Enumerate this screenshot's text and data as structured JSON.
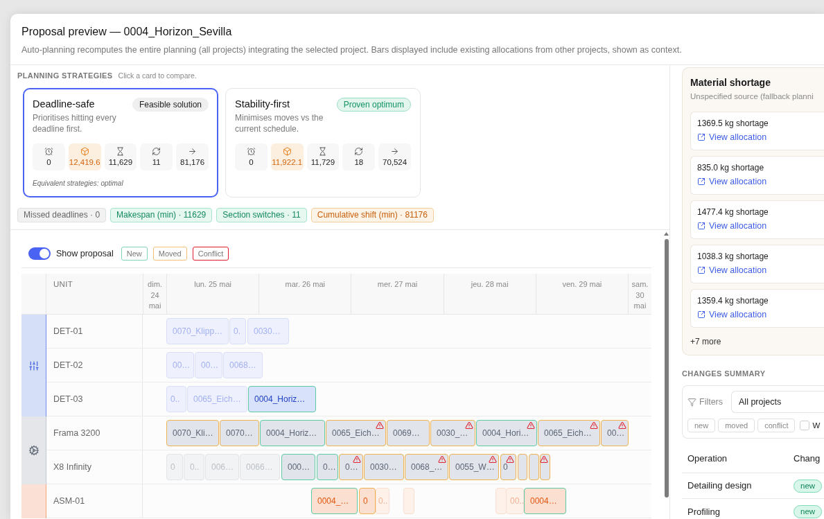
{
  "dialog": {
    "title": "Proposal preview — 0004_Horizon_Sevilla",
    "subtitle": "Auto-planning recomputes the entire planning (all projects) integrating the selected project. Bars displayed include existing allocations from other projects, shown as context."
  },
  "strategies": {
    "heading": "PLANNING STRATEGIES",
    "hint": "Click a card to compare.",
    "cards": [
      {
        "title": "Deadline-safe",
        "selected": true,
        "badge": {
          "label": "Feasible solution",
          "kind": "feasible"
        },
        "description": "Prioritises hitting every deadline first.",
        "metrics": [
          {
            "kind": "deadlines",
            "value": "0",
            "warning": false
          },
          {
            "kind": "material",
            "value": "12,419.6",
            "warning": true
          },
          {
            "kind": "makespan",
            "value": "11,629",
            "warning": false
          },
          {
            "kind": "switches",
            "value": "11",
            "warning": false
          },
          {
            "kind": "shift",
            "value": "81,176",
            "warning": false
          }
        ],
        "note": "Equivalent strategies: optimal"
      },
      {
        "title": "Stability-first",
        "selected": false,
        "badge": {
          "label": "Proven optimum",
          "kind": "optimal"
        },
        "description": "Minimises moves vs the current schedule.",
        "metrics": [
          {
            "kind": "deadlines",
            "value": "0",
            "warning": false
          },
          {
            "kind": "material",
            "value": "11,922.1",
            "warning": true
          },
          {
            "kind": "makespan",
            "value": "11,729",
            "warning": false
          },
          {
            "kind": "switches",
            "value": "18",
            "warning": false
          },
          {
            "kind": "shift",
            "value": "70,524",
            "warning": false
          }
        ]
      }
    ],
    "kpis": [
      {
        "label": "Missed deadlines · 0",
        "kind": "neutral"
      },
      {
        "label": "Makespan (min) · 11629",
        "kind": "good"
      },
      {
        "label": "Section switches · 11",
        "kind": "good"
      },
      {
        "label": "Cumulative shift (min) · 81176",
        "kind": "warning"
      }
    ]
  },
  "proposal": {
    "label": "Show proposal",
    "on": true,
    "legend": [
      {
        "label": "New",
        "kind": "new"
      },
      {
        "label": "Moved",
        "kind": "moved"
      },
      {
        "label": "Conflict",
        "kind": "conflict"
      }
    ]
  },
  "gantt": {
    "unit_header": "UNIT",
    "days": [
      {
        "label": "dim. 24 mai",
        "kind": "weekend"
      },
      {
        "label": "lun. 25 mai",
        "kind": "weekday"
      },
      {
        "label": "mar. 26 mai",
        "kind": "weekday"
      },
      {
        "label": "mer. 27 mai",
        "kind": "weekday"
      },
      {
        "label": "jeu. 28 mai",
        "kind": "weekday"
      },
      {
        "label": "ven. 29 mai",
        "kind": "weekday"
      },
      {
        "label": "sam. 30 mai",
        "kind": "weekend"
      }
    ],
    "groups": [
      {
        "kind": "detailing",
        "color": "#d5dff7",
        "units": [
          {
            "name": "DET-01",
            "bars": [
              {
                "label": "0070_Klipp…",
                "kind": "context",
                "conflict": false
              },
              {
                "label": "0.",
                "kind": "context",
                "conflict": false
              },
              {
                "label": "0030…",
                "kind": "context",
                "conflict": false
              }
            ]
          },
          {
            "name": "DET-02",
            "bars": [
              {
                "label": "00…",
                "kind": "context",
                "conflict": false
              },
              {
                "label": "00…",
                "kind": "context",
                "conflict": false
              },
              {
                "label": "0068…",
                "kind": "context",
                "conflict": false
              }
            ]
          },
          {
            "name": "DET-03",
            "bars": [
              {
                "label": "0..",
                "kind": "context",
                "conflict": false
              },
              {
                "label": "0065_Eich…",
                "kind": "context",
                "conflict": false
              },
              {
                "label": "0004_Horiz…",
                "kind": "new",
                "conflict": false
              }
            ]
          }
        ]
      },
      {
        "kind": "framing",
        "color": "#e4e6ea",
        "units": [
          {
            "name": "Frama 3200",
            "bars": [
              {
                "label": "0070_Kli…",
                "kind": "moved",
                "conflict": false
              },
              {
                "label": "0070…",
                "kind": "moved",
                "conflict": false
              },
              {
                "label": "0004_Horiz…",
                "kind": "new",
                "conflict": false
              },
              {
                "label": "0065_Eich…",
                "kind": "moved",
                "conflict": true
              },
              {
                "label": "0069…",
                "kind": "moved",
                "conflict": false
              },
              {
                "label": "0030_…",
                "kind": "moved",
                "conflict": true
              },
              {
                "label": "0004_Hori…",
                "kind": "new",
                "conflict": true
              },
              {
                "label": "0065_Eich…",
                "kind": "moved",
                "conflict": true
              },
              {
                "label": "00…",
                "kind": "moved",
                "conflict": true
              }
            ]
          },
          {
            "name": "X8 Infinity",
            "bars": [
              {
                "label": "0",
                "kind": "context",
                "conflict": false
              },
              {
                "label": "0..",
                "kind": "context",
                "conflict": false
              },
              {
                "label": "006…",
                "kind": "context",
                "conflict": false
              },
              {
                "label": "0066…",
                "kind": "context",
                "conflict": false
              },
              {
                "label": "000…",
                "kind": "new",
                "conflict": false
              },
              {
                "label": "0…",
                "kind": "new",
                "conflict": false
              },
              {
                "label": "0…",
                "kind": "moved",
                "conflict": true
              },
              {
                "label": "0030…",
                "kind": "moved",
                "conflict": false
              },
              {
                "label": "0068_…",
                "kind": "moved",
                "conflict": true
              },
              {
                "label": "0055_W…",
                "kind": "moved",
                "conflict": true
              },
              {
                "label": "0",
                "kind": "moved",
                "conflict": true
              },
              {
                "kind": "moved",
                "conflict": false
              },
              {
                "kind": "moved",
                "conflict": false
              },
              {
                "kind": "moved",
                "conflict": true
              }
            ]
          }
        ]
      },
      {
        "kind": "assembly",
        "color": "#fbe1d5",
        "units": [
          {
            "name": "ASM-01",
            "bars": [
              {
                "label": "0004_…",
                "kind": "new",
                "conflict": false
              },
              {
                "label": "0",
                "kind": "moved",
                "conflict": false
              },
              {
                "label": "0..",
                "kind": "context",
                "conflict": false
              },
              {
                "kind": "context",
                "conflict": false
              },
              {
                "kind": "context",
                "conflict": false
              },
              {
                "label": "00..",
                "kind": "context",
                "conflict": false
              },
              {
                "label": "0004…",
                "kind": "new",
                "conflict": false
              }
            ]
          }
        ]
      }
    ]
  },
  "material_shortage": {
    "title": "Material shortage",
    "subtitle": "Unspecified source (fallback planni",
    "items": [
      {
        "amount": "1369.5 kg shortage",
        "link": "View allocation"
      },
      {
        "amount": "835.0 kg shortage",
        "link": "View allocation"
      },
      {
        "amount": "1477.4 kg shortage",
        "link": "View allocation"
      },
      {
        "amount": "1038.3 kg shortage",
        "link": "View allocation"
      },
      {
        "amount": "1359.4 kg shortage",
        "link": "View allocation"
      }
    ],
    "more": "+7 more"
  },
  "changes_summary": {
    "heading": "CHANGES SUMMARY",
    "filters_label": "Filters",
    "project_select": {
      "value": "All projects"
    },
    "chips": [
      {
        "label": "new",
        "selected": false
      },
      {
        "label": "moved",
        "selected": false
      },
      {
        "label": "conflict",
        "selected": false
      }
    ],
    "checkbox": {
      "label": "W",
      "checked": false
    },
    "columns": [
      "Operation",
      "Chang"
    ],
    "rows": [
      {
        "operation": "Detailing design",
        "change": {
          "label": "new",
          "kind": "new"
        }
      },
      {
        "operation": "Profiling",
        "change": {
          "label": "new",
          "kind": "new"
        }
      }
    ]
  }
}
